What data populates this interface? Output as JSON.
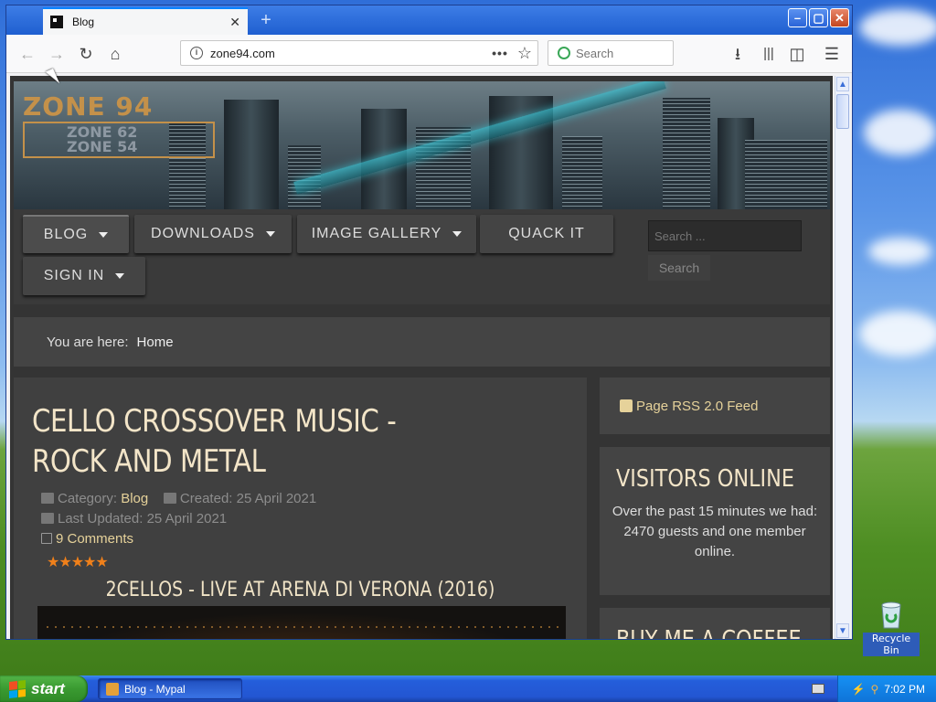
{
  "browser": {
    "tab_title": "Blog",
    "url": "zone94.com",
    "search_placeholder": "Search",
    "window_buttons": {
      "minimize": "–",
      "maximize": "▢",
      "close": "✕"
    }
  },
  "site": {
    "logo_line1": "ZONE 94",
    "logo_line2": "ZONE 62",
    "logo_line3": "ZONE 54",
    "menu": [
      {
        "label": "BLOG",
        "dropdown": true,
        "active": true
      },
      {
        "label": "DOWNLOADS",
        "dropdown": true
      },
      {
        "label": "IMAGE GALLERY",
        "dropdown": true
      },
      {
        "label": "QUACK IT",
        "dropdown": false
      },
      {
        "label": "SIGN IN",
        "dropdown": true
      }
    ],
    "search_placeholder": "Search ...",
    "search_button": "Search",
    "breadcrumb": {
      "prefix": "You are here:",
      "current": "Home"
    },
    "article": {
      "title": "CELLO CROSSOVER MUSIC - ROCK AND METAL",
      "category_label": "Category:",
      "category": "Blog",
      "created": "Created: 25 April 2021",
      "updated": "Last Updated: 25 April 2021",
      "comments": "9 Comments",
      "rating": 5,
      "stars": "★★★★★",
      "subtitle": "2CELLOS - LIVE AT ARENA DI VERONA (2016)"
    },
    "sidebar": {
      "rss": "Page RSS 2.0 Feed",
      "visitors_title": "VISITORS ONLINE",
      "visitors_text1": "Over the past 15 minutes we had:",
      "visitors_text2": "2470 guests and one member online.",
      "coffee_title": "BUY ME A COFFEE"
    }
  },
  "desktop": {
    "recycle_bin": "Recycle Bin",
    "start": "start",
    "task": "Blog - Mypal",
    "clock": "7:02 PM"
  },
  "colors": {
    "accent": "#e6d29a",
    "title": "#f3e5c8",
    "page_bg": "#343434",
    "stars": "#f0801a"
  }
}
